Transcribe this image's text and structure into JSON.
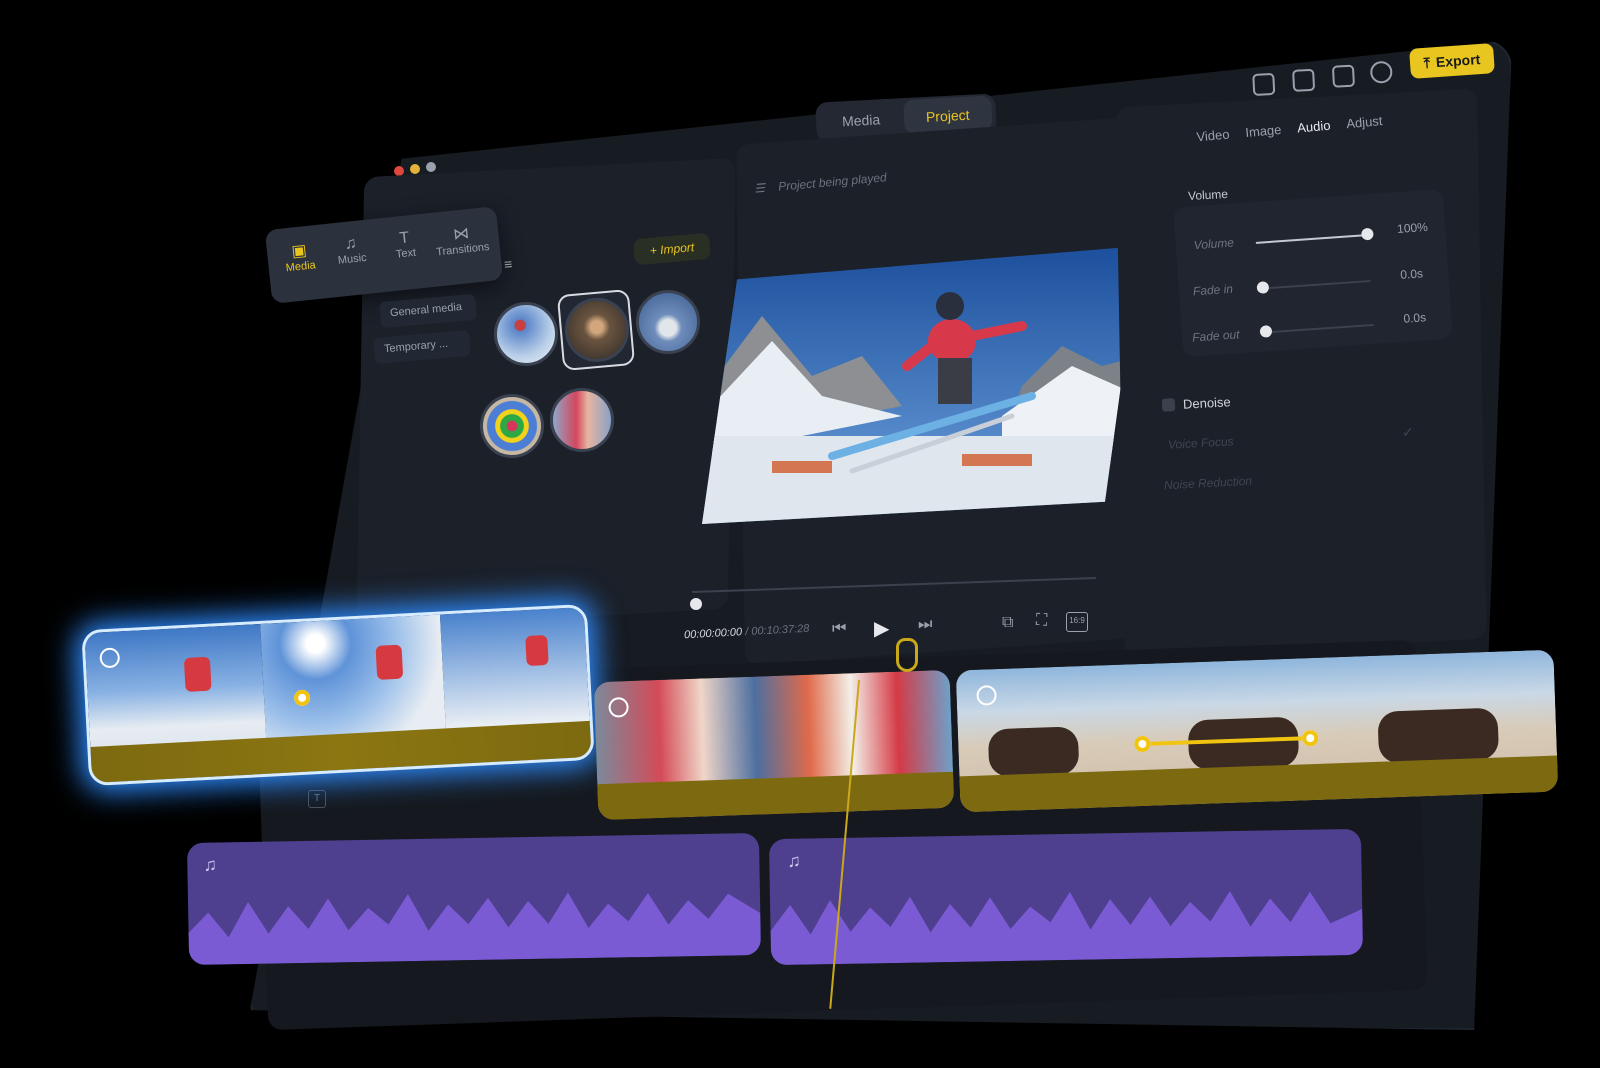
{
  "header": {
    "tabs": [
      {
        "label": "Media",
        "active": false
      },
      {
        "label": "Project",
        "active": true
      }
    ],
    "export_label": "Export",
    "accent": "#e9c61f"
  },
  "library": {
    "nav": [
      {
        "label": "Media",
        "icon": "folder-play-icon",
        "active": true
      },
      {
        "label": "Music",
        "icon": "music-note-icon",
        "active": false
      },
      {
        "label": "Text",
        "icon": "text-box-icon",
        "active": false
      },
      {
        "label": "Transitions",
        "icon": "transition-icon",
        "active": false
      }
    ],
    "folders": [
      "General media",
      "Temporary ..."
    ],
    "import_label": "+ Import"
  },
  "preview": {
    "placeholder": "Project being played",
    "current_time": "00:00:00:00",
    "total_time": "00:10:37:28",
    "aspect_label": "16:9",
    "progress": 0.0
  },
  "inspector": {
    "tabs": [
      "Video",
      "Image",
      "Audio",
      "Adjust"
    ],
    "active_tab": "Audio",
    "section_title": "Volume",
    "rows": [
      {
        "label": "Volume",
        "value": "100%",
        "level": 1.0
      },
      {
        "label": "Fade in",
        "value": "0.0s",
        "level": 0.0
      },
      {
        "label": "Fade out",
        "value": "0.0s",
        "level": 0.0
      }
    ],
    "denoise_label": "Denoise",
    "denoise_options": [
      "Voice Focus",
      "Noise Reduction"
    ]
  },
  "colors": {
    "audio_band": "#7d6a10",
    "music_track": "#4f3f8f",
    "music_wave": "#7a5bd3",
    "selection_glow": "#3aa0ff"
  }
}
